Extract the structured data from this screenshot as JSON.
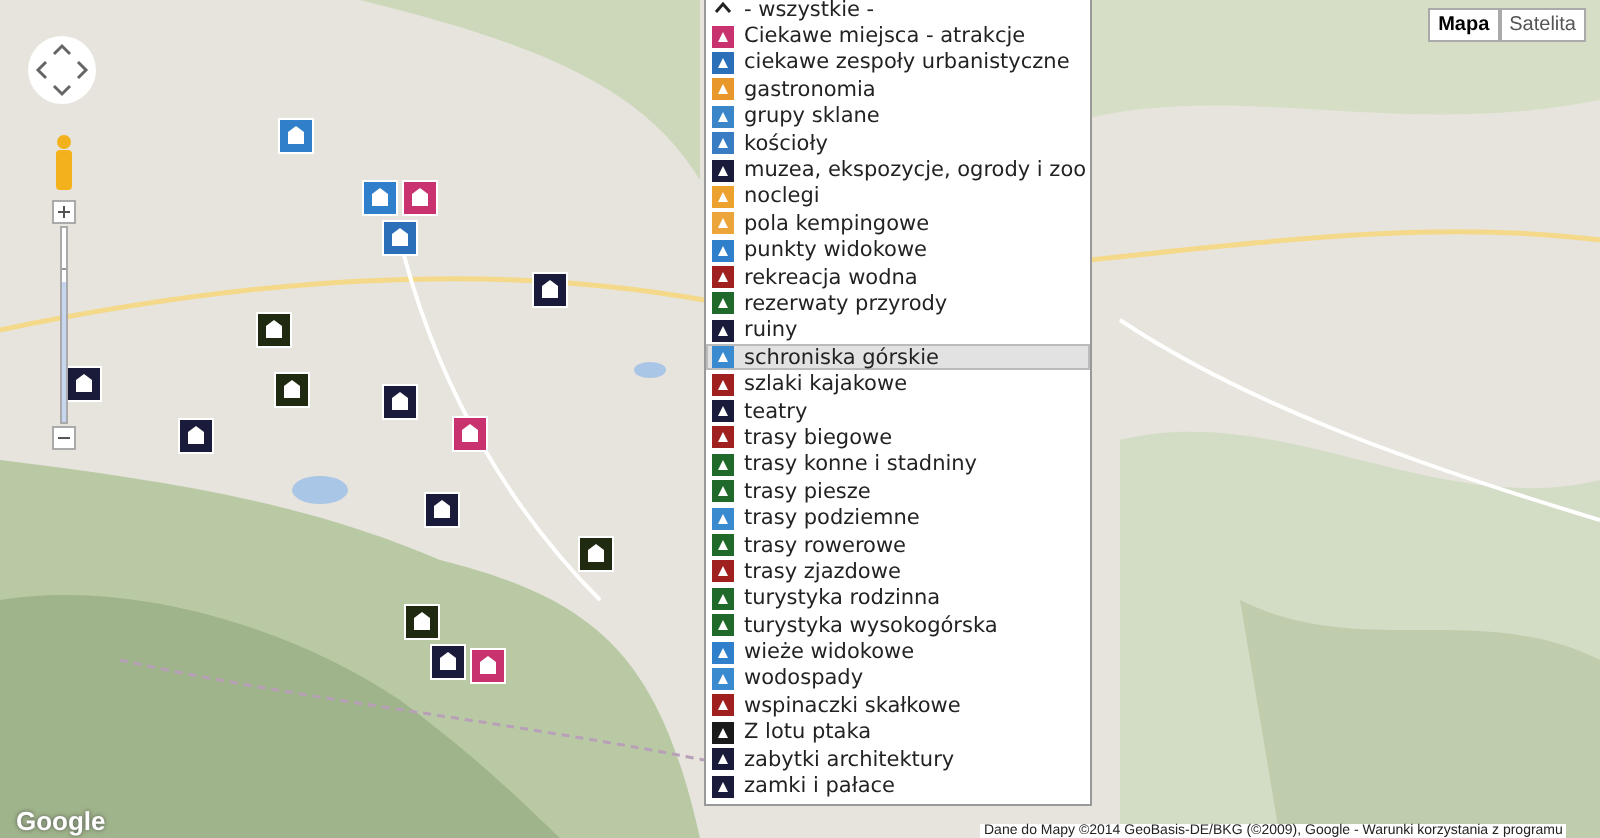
{
  "map_type_buttons": [
    {
      "label": "Mapa",
      "selected": true
    },
    {
      "label": "Satelita",
      "selected": false
    }
  ],
  "attribution": "Dane do Mapy ©2014 GeoBasis-DE/BKG (©2009), Google - Warunki korzystania z programu",
  "logo": "Google",
  "zoom_slider": {
    "level": 0.72
  },
  "category_list": {
    "items": [
      {
        "label": "- wszystkie -",
        "kind": "all",
        "selected": false
      },
      {
        "label": "Ciekawe miejsca - atrakcje",
        "kind": "category",
        "color": "#c8326e",
        "selected": false
      },
      {
        "label": "ciekawe zespoły urbanistyczne",
        "kind": "category",
        "color": "#2a6fb8",
        "selected": false
      },
      {
        "label": "gastronomia",
        "kind": "category",
        "color": "#e8982a",
        "selected": false
      },
      {
        "label": "grupy sklane",
        "kind": "category",
        "color": "#3a86c8",
        "selected": false
      },
      {
        "label": "kościoły",
        "kind": "category",
        "color": "#3a7cc4",
        "selected": false
      },
      {
        "label": "muzea, ekspozycje, ogrody i zoo",
        "kind": "category",
        "color": "#1a1a3a",
        "selected": false
      },
      {
        "label": "noclegi",
        "kind": "category",
        "color": "#eda12e",
        "selected": false
      },
      {
        "label": "pola kempingowe",
        "kind": "category",
        "color": "#eba53a",
        "selected": false
      },
      {
        "label": "punkty widokowe",
        "kind": "category",
        "color": "#2f7fcb",
        "selected": false
      },
      {
        "label": "rekreacja wodna",
        "kind": "category",
        "color": "#a02020",
        "selected": false
      },
      {
        "label": "rezerwaty przyrody",
        "kind": "category",
        "color": "#1f6a2a",
        "selected": false
      },
      {
        "label": "ruiny",
        "kind": "category",
        "color": "#1a1a3a",
        "selected": false
      },
      {
        "label": "schroniska górskie",
        "kind": "category",
        "color": "#3a8ad0",
        "selected": true
      },
      {
        "label": "szlaki kajakowe",
        "kind": "category",
        "color": "#a02020",
        "selected": false
      },
      {
        "label": "teatry",
        "kind": "category",
        "color": "#1a1a3a",
        "selected": false
      },
      {
        "label": "trasy biegowe",
        "kind": "category",
        "color": "#a02020",
        "selected": false
      },
      {
        "label": "trasy konne i stadniny",
        "kind": "category",
        "color": "#1f6a2a",
        "selected": false
      },
      {
        "label": "trasy piesze",
        "kind": "category",
        "color": "#1f6a2a",
        "selected": false
      },
      {
        "label": "trasy podziemne",
        "kind": "category",
        "color": "#3a8ad0",
        "selected": false
      },
      {
        "label": "trasy rowerowe",
        "kind": "category",
        "color": "#1f6a2a",
        "selected": false
      },
      {
        "label": "trasy zjazdowe",
        "kind": "category",
        "color": "#a02020",
        "selected": false
      },
      {
        "label": "turystyka rodzinna",
        "kind": "category",
        "color": "#1f6a2a",
        "selected": false
      },
      {
        "label": "turystyka wysokogórska",
        "kind": "category",
        "color": "#1f6a2a",
        "selected": false
      },
      {
        "label": "wieże widokowe",
        "kind": "category",
        "color": "#2f7fcb",
        "selected": false
      },
      {
        "label": "wodospady",
        "kind": "category",
        "color": "#3a8ad0",
        "selected": false
      },
      {
        "label": "wspinaczki skałkowe",
        "kind": "category",
        "color": "#a02020",
        "selected": false
      },
      {
        "label": "Z lotu ptaka",
        "kind": "category",
        "color": "#1a1a1a",
        "selected": false
      },
      {
        "label": "zabytki architektury",
        "kind": "category",
        "color": "#1a1a3a",
        "selected": false
      },
      {
        "label": "zamki i pałace",
        "kind": "category",
        "color": "#1a1a3a",
        "selected": false
      }
    ]
  }
}
